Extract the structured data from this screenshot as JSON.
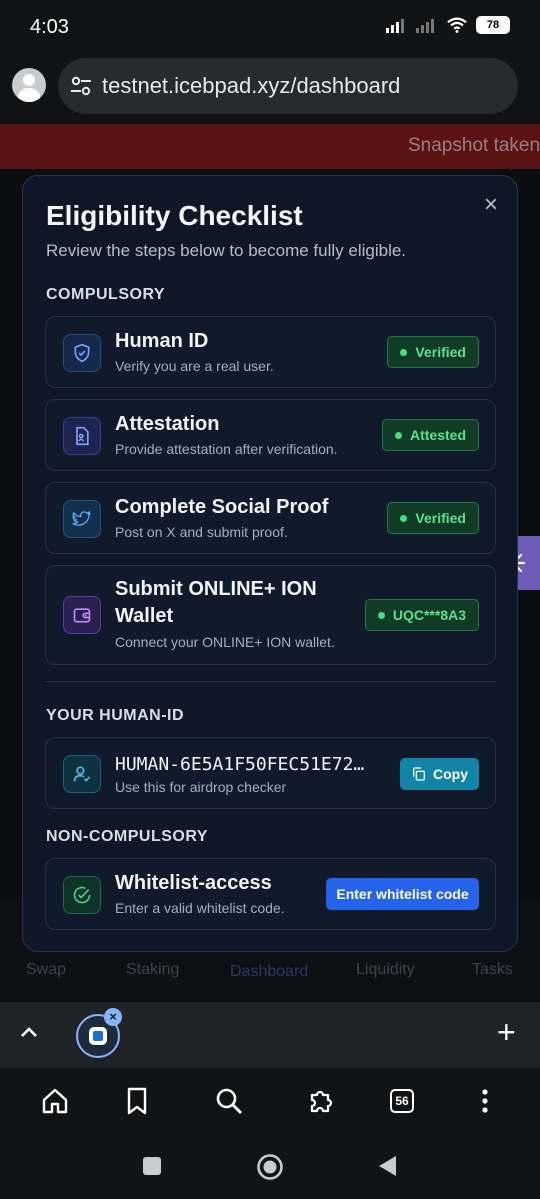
{
  "status_bar": {
    "time": "4:03",
    "battery": "78"
  },
  "browser": {
    "url": "testnet.icebpad.xyz/dashboard",
    "tab_count": "56"
  },
  "page": {
    "banner_text": "Snapshot taken",
    "bottom_nav": [
      "Swap",
      "Staking",
      "Dashboard",
      "Liquidity",
      "Tasks"
    ]
  },
  "modal": {
    "title": "Eligibility Checklist",
    "subtitle": "Review the steps below to become fully eligible.",
    "close_label": "×",
    "compulsory_heading": "COMPULSORY",
    "compulsory_items": [
      {
        "title": "Human ID",
        "description": "Verify you are a real user.",
        "status": "Verified",
        "icon": "shield-icon"
      },
      {
        "title": "Attestation",
        "description": "Provide attestation after verification.",
        "status": "Attested",
        "icon": "document-icon"
      },
      {
        "title": "Complete Social Proof",
        "description": "Post on X and submit proof.",
        "status": "Verified",
        "icon": "twitter-icon"
      },
      {
        "title": "Submit ONLINE+ ION Wallet",
        "description": "Connect your ONLINE+ ION wallet.",
        "status": "UQC***8A3",
        "icon": "wallet-icon"
      }
    ],
    "human_id_heading": "YOUR HUMAN-ID",
    "human_id": {
      "value": "HUMAN-6E5A1F50FEC51E72…",
      "description": "Use this for airdrop checker",
      "copy_label": "Copy"
    },
    "non_compulsory_heading": "NON-COMPULSORY",
    "whitelist": {
      "title": "Whitelist-access",
      "description": "Enter a valid whitelist code.",
      "button_label": "Enter whitelist code"
    }
  },
  "colors": {
    "modal_bg": "#0f1726",
    "badge_green": "#5fe08f",
    "copy_button": "#1284a8",
    "primary_button": "#2563eb",
    "banner_red": "#5b1214"
  }
}
